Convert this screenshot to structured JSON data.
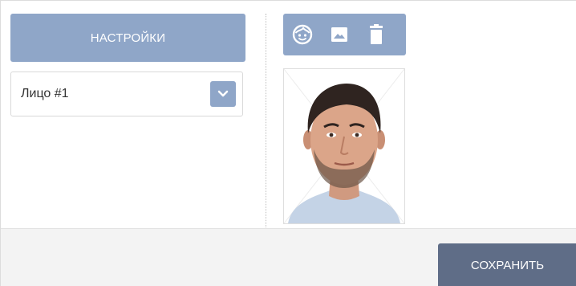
{
  "settings": {
    "button_label": "НАСТРОЙКИ"
  },
  "face_select": {
    "selected": "Лицо #1"
  },
  "toolbar": {
    "icons": [
      "face-icon",
      "image-icon",
      "trash-icon"
    ]
  },
  "footer": {
    "save_label": "СОХРАНИТЬ"
  },
  "colors": {
    "accent": "#8fa6c8",
    "save_button": "#5f6d87",
    "footer_bg": "#f3f3f3"
  }
}
